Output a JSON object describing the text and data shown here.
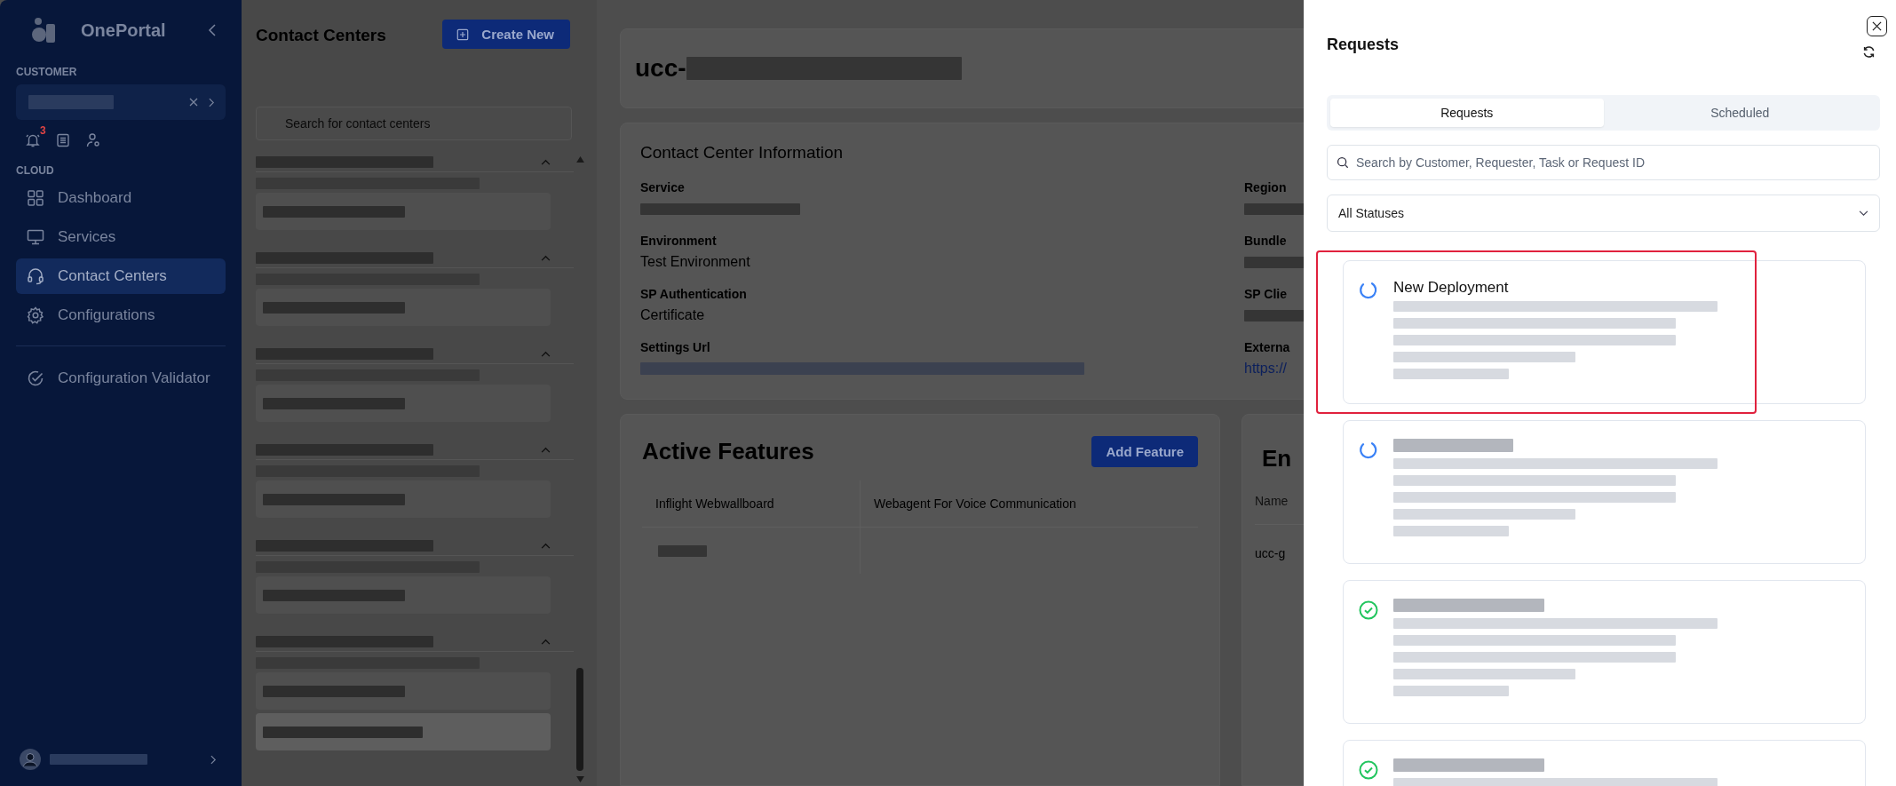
{
  "sidebar": {
    "brand": "OnePortal",
    "customer_label": "CUSTOMER",
    "notification_badge": "3",
    "section_label": "CLOUD",
    "nav": [
      {
        "label": "Dashboard",
        "selected": false
      },
      {
        "label": "Services",
        "selected": false
      },
      {
        "label": "Contact Centers",
        "selected": true
      },
      {
        "label": "Configurations",
        "selected": false
      }
    ],
    "footer_nav": [
      {
        "label": "Configuration Validator",
        "selected": false
      }
    ]
  },
  "contact_list": {
    "title": "Contact Centers",
    "create_button": "Create New",
    "search_placeholder": "Search for contact centers",
    "groups": [
      {
        "expanded": true,
        "children": [
          {
            "selected": false
          }
        ]
      },
      {
        "expanded": true,
        "children": [
          {
            "selected": false
          }
        ]
      },
      {
        "expanded": true,
        "children": [
          {
            "selected": false
          }
        ]
      },
      {
        "expanded": true,
        "children": [
          {
            "selected": false
          }
        ]
      },
      {
        "expanded": true,
        "children": [
          {
            "selected": false
          }
        ]
      },
      {
        "expanded": true,
        "children": [
          {
            "selected": false
          },
          {
            "selected": true
          }
        ]
      }
    ]
  },
  "detail": {
    "title_prefix": "ucc-",
    "info": {
      "title": "Contact Center Information",
      "left_fields": [
        {
          "label": "Service",
          "kind": "redacted"
        },
        {
          "label": "Environment",
          "kind": "text",
          "value": "Test Environment"
        },
        {
          "label": "SP Authentication",
          "kind": "text",
          "value": "Certificate"
        },
        {
          "label": "Settings Url",
          "kind": "redacted_link"
        }
      ],
      "right_fields": [
        {
          "label": "Region",
          "kind": "redacted"
        },
        {
          "label": "Bundle",
          "kind": "redacted"
        },
        {
          "label": "SP Clie",
          "kind": "redacted"
        },
        {
          "label": "Externa",
          "kind": "link",
          "value": "https://"
        }
      ]
    },
    "features": {
      "title": "Active Features",
      "button": "Add Feature",
      "columns": [
        "Inflight Webwallboard",
        "Webagent For Voice Communication"
      ],
      "rows": [
        [
          {
            "kind": "redacted"
          },
          {
            "kind": "empty"
          }
        ]
      ]
    },
    "endpoints": {
      "title": "En",
      "columns": [
        "Name"
      ],
      "rows": [
        [
          "ucc-g"
        ]
      ]
    }
  },
  "requests_panel": {
    "title": "Requests",
    "tabs": [
      {
        "label": "Requests",
        "selected": true
      },
      {
        "label": "Scheduled",
        "selected": false
      }
    ],
    "search_placeholder": "Search by Customer, Requester, Task or Request ID",
    "status_filter": "All Statuses",
    "items": [
      {
        "kind": "in_progress",
        "title": "New Deployment",
        "highlighted": true
      },
      {
        "kind": "in_progress",
        "highlighted": false
      },
      {
        "kind": "completed",
        "highlighted": false
      },
      {
        "kind": "completed",
        "highlighted": false
      }
    ]
  }
}
